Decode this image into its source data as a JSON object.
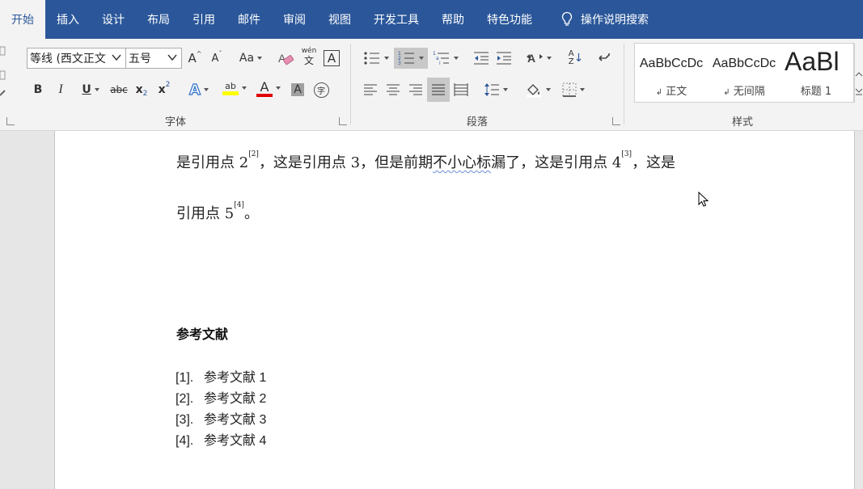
{
  "menu": {
    "tabs": [
      {
        "label": "开始"
      },
      {
        "label": "插入"
      },
      {
        "label": "设计"
      },
      {
        "label": "布局"
      },
      {
        "label": "引用"
      },
      {
        "label": "邮件"
      },
      {
        "label": "审阅"
      },
      {
        "label": "视图"
      },
      {
        "label": "开发工具"
      },
      {
        "label": "帮助"
      },
      {
        "label": "特色功能"
      }
    ],
    "search_label": "操作说明搜索",
    "active_tab": "开始",
    "accent_color": "#2b579a"
  },
  "ribbon": {
    "font_group": {
      "label": "字体",
      "font_name": "等线 (西文正文",
      "font_size": "五号",
      "grow_font": "A",
      "shrink_font": "A",
      "change_case": "Aa",
      "phonetic_top": "wén",
      "phonetic_bottom": "文",
      "char_border": "A",
      "bold": "B",
      "italic": "I",
      "underline": "U",
      "strike": "abc",
      "subscript": "x",
      "subscript_small": "2",
      "superscript": "x",
      "superscript_small": "2",
      "text_effect": "A",
      "highlight": "ab",
      "font_color": "A",
      "char_shading": "A",
      "enclose_char": "字",
      "highlight_color": "#ffff00",
      "font_color_value": "#e00000"
    },
    "paragraph_group": {
      "label": "段落",
      "sort_top": "A",
      "sort_bottom": "Z"
    },
    "styles_group": {
      "label": "样式",
      "items": [
        {
          "sample": "AaBbCcDc",
          "name": "正文"
        },
        {
          "sample": "AaBbCcDc",
          "name": "无间隔"
        },
        {
          "sample": "AaBl",
          "name": "标题 1"
        }
      ]
    }
  },
  "document": {
    "line1": {
      "t1": "是引用点 2",
      "s1": "[2]",
      "t2": "，这是引用点 3，但是前期",
      "squiggle": "不小心标",
      "t3": "漏了，这是引用点 4",
      "s2": "[3]",
      "t4": "，这是"
    },
    "line2": {
      "t1": "引用点 5",
      "s1": "[4]",
      "t2": "。"
    },
    "references_heading": "参考文献",
    "references": [
      {
        "num": "[1].",
        "text": "参考文献 1"
      },
      {
        "num": "[2].",
        "text": "参考文献 2"
      },
      {
        "num": "[3].",
        "text": "参考文献 3"
      },
      {
        "num": "[4].",
        "text": "参考文献 4"
      }
    ]
  }
}
